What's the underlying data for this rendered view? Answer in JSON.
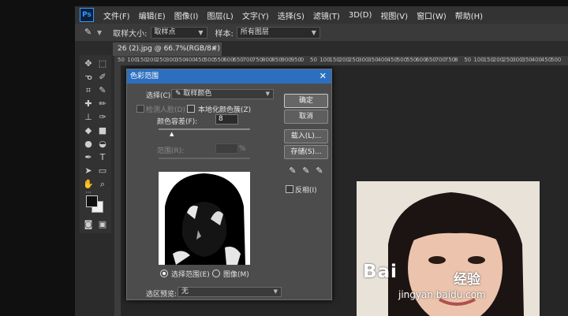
{
  "menu": [
    "文件(F)",
    "编辑(E)",
    "图像(I)",
    "图层(L)",
    "文字(Y)",
    "选择(S)",
    "滤镜(T)",
    "3D(D)",
    "视图(V)",
    "窗口(W)",
    "帮助(H)"
  ],
  "app_logo": "Ps",
  "options_bar": {
    "sample_size_label": "取样大小:",
    "sample_size_value": "取样点",
    "sample_label": "样本:",
    "sample_value": "所有图层"
  },
  "document": {
    "tab_title": "26 (2).jpg @ 66.7%(RGB/8#) *",
    "tab_close": "×",
    "ruler_ticks": [
      "50",
      "100",
      "150",
      "200",
      "250",
      "300",
      "350",
      "400",
      "450",
      "500",
      "550",
      "600",
      "650",
      "700",
      "750",
      "800",
      "850",
      "900",
      "950",
      "0",
      "50",
      "100",
      "150",
      "200",
      "250",
      "300",
      "350",
      "400",
      "450",
      "500",
      "550",
      "600",
      "650",
      "700",
      "750",
      "8",
      "50",
      "100",
      "150",
      "200",
      "250",
      "300",
      "350",
      "400",
      "450",
      "500",
      "550"
    ]
  },
  "dialog": {
    "title": "色彩范围",
    "close": "✕",
    "select_label": "选择(C):",
    "select_value": "取样颜色",
    "detect_faces": "检测人脸(D)",
    "localized_color": "本地化颜色簇(Z)",
    "fuzziness_label": "颜色容差(F):",
    "fuzziness_value": "8",
    "range_label": "范围(R):",
    "range_unit": "%",
    "radio_selection": "选择范围(E)",
    "radio_image": "图像(M)",
    "preview_label": "选区预览:",
    "preview_value": "无",
    "buttons": {
      "ok": "确定",
      "cancel": "取消",
      "load": "载入(L)...",
      "save": "存储(S)..."
    },
    "invert": "反相(I)"
  },
  "watermark": {
    "bai": "Bai",
    "jingyan": "经验",
    "url": "jingyan.baidu.com"
  }
}
